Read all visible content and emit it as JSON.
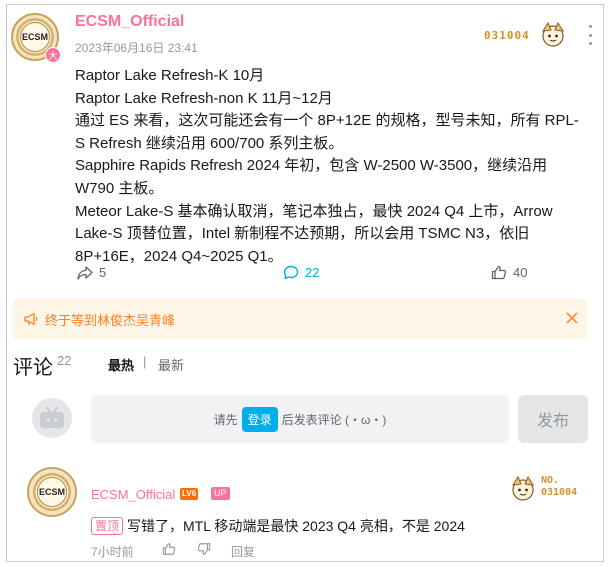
{
  "post": {
    "author": "ECSM_Official",
    "avatar_text": "ECSM",
    "badge": "大",
    "date": "2023年06月16日 23:41",
    "fan_number": "031004",
    "content": [
      "Raptor Lake Refresh-K 10月",
      "Raptor Lake Refresh-non K 11月~12月",
      "通过 ES 来看，这次可能还会有一个 8P+12E 的规格，型号未知，所有 RPL-S Refresh 继续沿用 600/700 系列主板。",
      "Sapphire Rapids Refresh 2024 年初，包含 W-2500 W-3500，继续沿用 W790 主板。",
      "Meteor Lake-S 基本确认取消，笔记本独占，最快 2024 Q4 上市，Arrow Lake-S 顶替位置，Intel 新制程不达预期，所以会用 TSMC N3，依旧 8P+16E，2024 Q4~2025 Q1。"
    ],
    "actions": {
      "share": "5",
      "comment": "22",
      "like": "40"
    }
  },
  "notice": {
    "text": "终于等到林俊杰吴青峰"
  },
  "comments": {
    "title": "评论",
    "count": "22",
    "sort_hot": "最热",
    "sort_sep": "|",
    "sort_new": "最新",
    "input_prefix": "请先",
    "login_label": "登录",
    "input_suffix": "后发表评论 (・ω・)",
    "publish_label": "发布",
    "reply": {
      "author": "ECSM_Official",
      "avatar_text": "ECSM",
      "level": "LV6",
      "up_tag": "UP",
      "fan_label": "NO.",
      "fan_number": "031004",
      "pin_label": "置顶",
      "text": "写错了，MTL 移动端是最快 2023 Q4 亮相，不是 2024",
      "time": "7小时前",
      "reply_label": "回复"
    }
  },
  "colors": {
    "accent": "#fb7299",
    "link": "#00aeec",
    "notice_bg": "#fdf6e6",
    "notice_text": "#ff7f24"
  }
}
